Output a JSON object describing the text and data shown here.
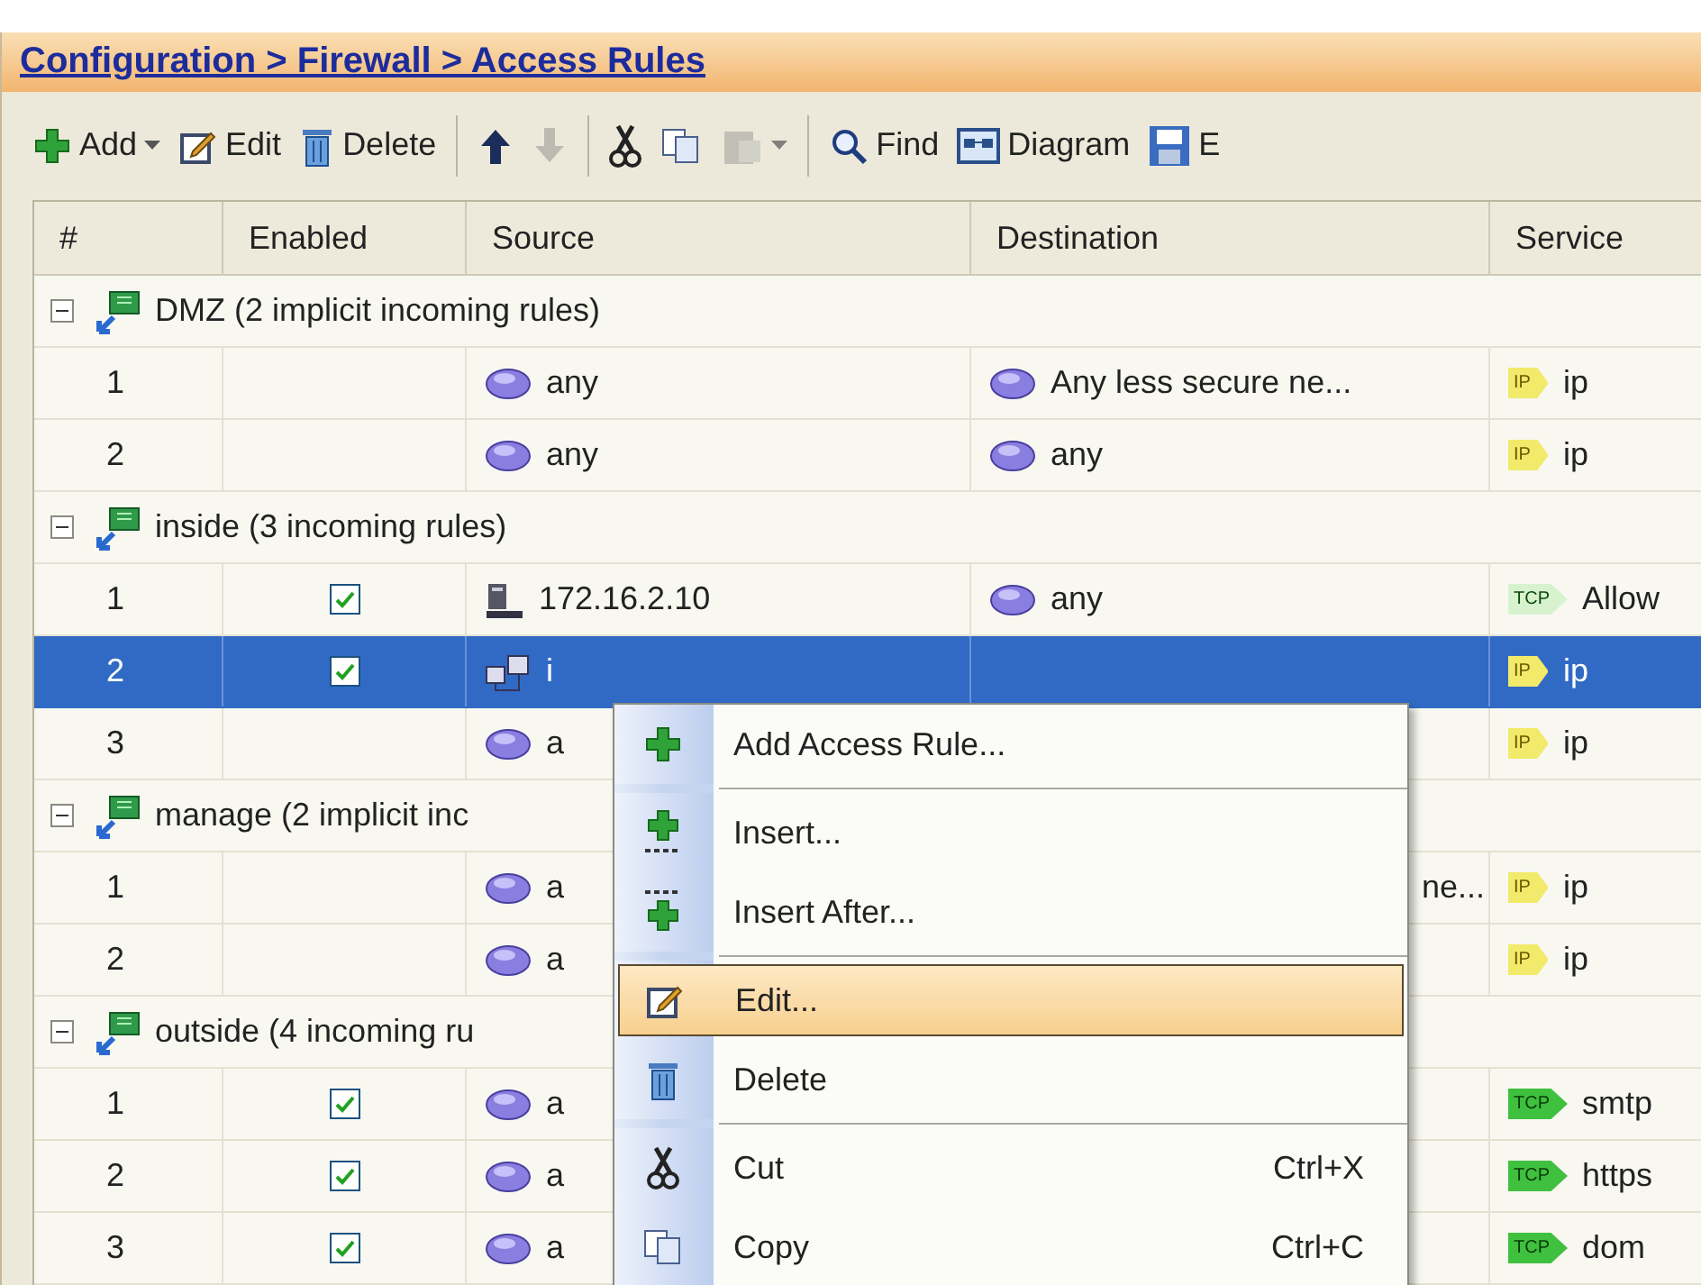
{
  "breadcrumb": "Configuration > Firewall > Access Rules",
  "toolbar": [
    {
      "kind": "add",
      "label": "Add",
      "has_menu": true,
      "disabled": false
    },
    {
      "kind": "edit",
      "label": "Edit",
      "has_menu": false,
      "disabled": false
    },
    {
      "kind": "delete",
      "label": "Delete",
      "has_menu": false,
      "disabled": false
    },
    {
      "kind": "separator"
    },
    {
      "kind": "up",
      "has_menu": false,
      "disabled": false
    },
    {
      "kind": "down",
      "has_menu": false,
      "disabled": true
    },
    {
      "kind": "separator"
    },
    {
      "kind": "cut",
      "has_menu": false,
      "disabled": false
    },
    {
      "kind": "copy",
      "has_menu": false,
      "disabled": false
    },
    {
      "kind": "paste",
      "has_menu": true,
      "disabled": true
    },
    {
      "kind": "separator"
    },
    {
      "kind": "find",
      "label": "Find",
      "has_menu": false,
      "disabled": false
    },
    {
      "kind": "diagram",
      "label": "Diagram",
      "has_menu": false,
      "disabled": false
    },
    {
      "kind": "export",
      "label": "E",
      "has_menu": false,
      "disabled": false
    }
  ],
  "table": {
    "columns": [
      "#",
      "Enabled",
      "Source",
      "Destination",
      "Service"
    ],
    "groups": [
      {
        "label": "DMZ (2 implicit incoming rules)",
        "expanded": true,
        "rows": [
          {
            "number": "1",
            "selected": false,
            "source": {
              "kind": "network",
              "text": "any"
            },
            "destination": {
              "kind": "network",
              "text": "Any less secure ne..."
            },
            "service": {
              "kind": "ip",
              "tag": "IP",
              "text": "ip"
            }
          },
          {
            "number": "2",
            "selected": false,
            "source": {
              "kind": "network",
              "text": "any"
            },
            "destination": {
              "kind": "network",
              "text": "any"
            },
            "service": {
              "kind": "ip",
              "tag": "IP",
              "text": "ip"
            }
          }
        ]
      },
      {
        "label": "inside (3 incoming rules)",
        "expanded": true,
        "rows": [
          {
            "number": "1",
            "checked": true,
            "selected": false,
            "source": {
              "kind": "host",
              "text": "172.16.2.10"
            },
            "destination": {
              "kind": "network",
              "text": "any"
            },
            "service": {
              "kind": "tcp-group",
              "tag": "TCP",
              "text": "Allow"
            }
          },
          {
            "number": "2",
            "checked": true,
            "selected": true,
            "source": {
              "kind": "subnet",
              "text": "i"
            },
            "service": {
              "kind": "ip",
              "tag": "IP",
              "text": "ip"
            }
          },
          {
            "number": "3",
            "selected": false,
            "source": {
              "kind": "network",
              "text": "a"
            },
            "service": {
              "kind": "ip",
              "tag": "IP",
              "text": "ip"
            }
          }
        ]
      },
      {
        "label": "manage (2 implicit inc",
        "expanded": true,
        "rows": [
          {
            "number": "1",
            "selected": false,
            "source": {
              "kind": "network",
              "text": "a"
            },
            "destination": {
              "kind": "tail",
              "text": "ne..."
            },
            "service": {
              "kind": "ip",
              "tag": "IP",
              "text": "ip"
            }
          },
          {
            "number": "2",
            "selected": false,
            "source": {
              "kind": "network",
              "text": "a"
            },
            "service": {
              "kind": "ip",
              "tag": "IP",
              "text": "ip"
            }
          }
        ]
      },
      {
        "label": "outside (4 incoming ru",
        "expanded": true,
        "rows": [
          {
            "number": "1",
            "checked": true,
            "selected": false,
            "source": {
              "kind": "network",
              "text": "a"
            },
            "service": {
              "kind": "tcp",
              "tag": "TCP",
              "text": "smtp"
            }
          },
          {
            "number": "2",
            "checked": true,
            "selected": false,
            "source": {
              "kind": "network",
              "text": "a"
            },
            "service": {
              "kind": "tcp",
              "tag": "TCP",
              "text": "https"
            }
          },
          {
            "number": "3",
            "checked": true,
            "selected": false,
            "source": {
              "kind": "network",
              "text": "a"
            },
            "service": {
              "kind": "tcp",
              "tag": "TCP",
              "text": "dom"
            }
          }
        ]
      }
    ]
  },
  "context_menu": [
    {
      "kind": "add",
      "label": "Add Access Rule...",
      "selected": false
    },
    {
      "kind": "separator"
    },
    {
      "kind": "insert",
      "label": "Insert...",
      "selected": false
    },
    {
      "kind": "insert-after",
      "label": "Insert After...",
      "selected": false
    },
    {
      "kind": "separator"
    },
    {
      "kind": "edit",
      "label": "Edit...",
      "selected": true
    },
    {
      "kind": "delete",
      "label": "Delete",
      "selected": false
    },
    {
      "kind": "separator"
    },
    {
      "kind": "cut",
      "label": "Cut",
      "shortcut": "Ctrl+X",
      "selected": false
    },
    {
      "kind": "copy",
      "label": "Copy",
      "shortcut": "Ctrl+C",
      "selected": false
    }
  ]
}
